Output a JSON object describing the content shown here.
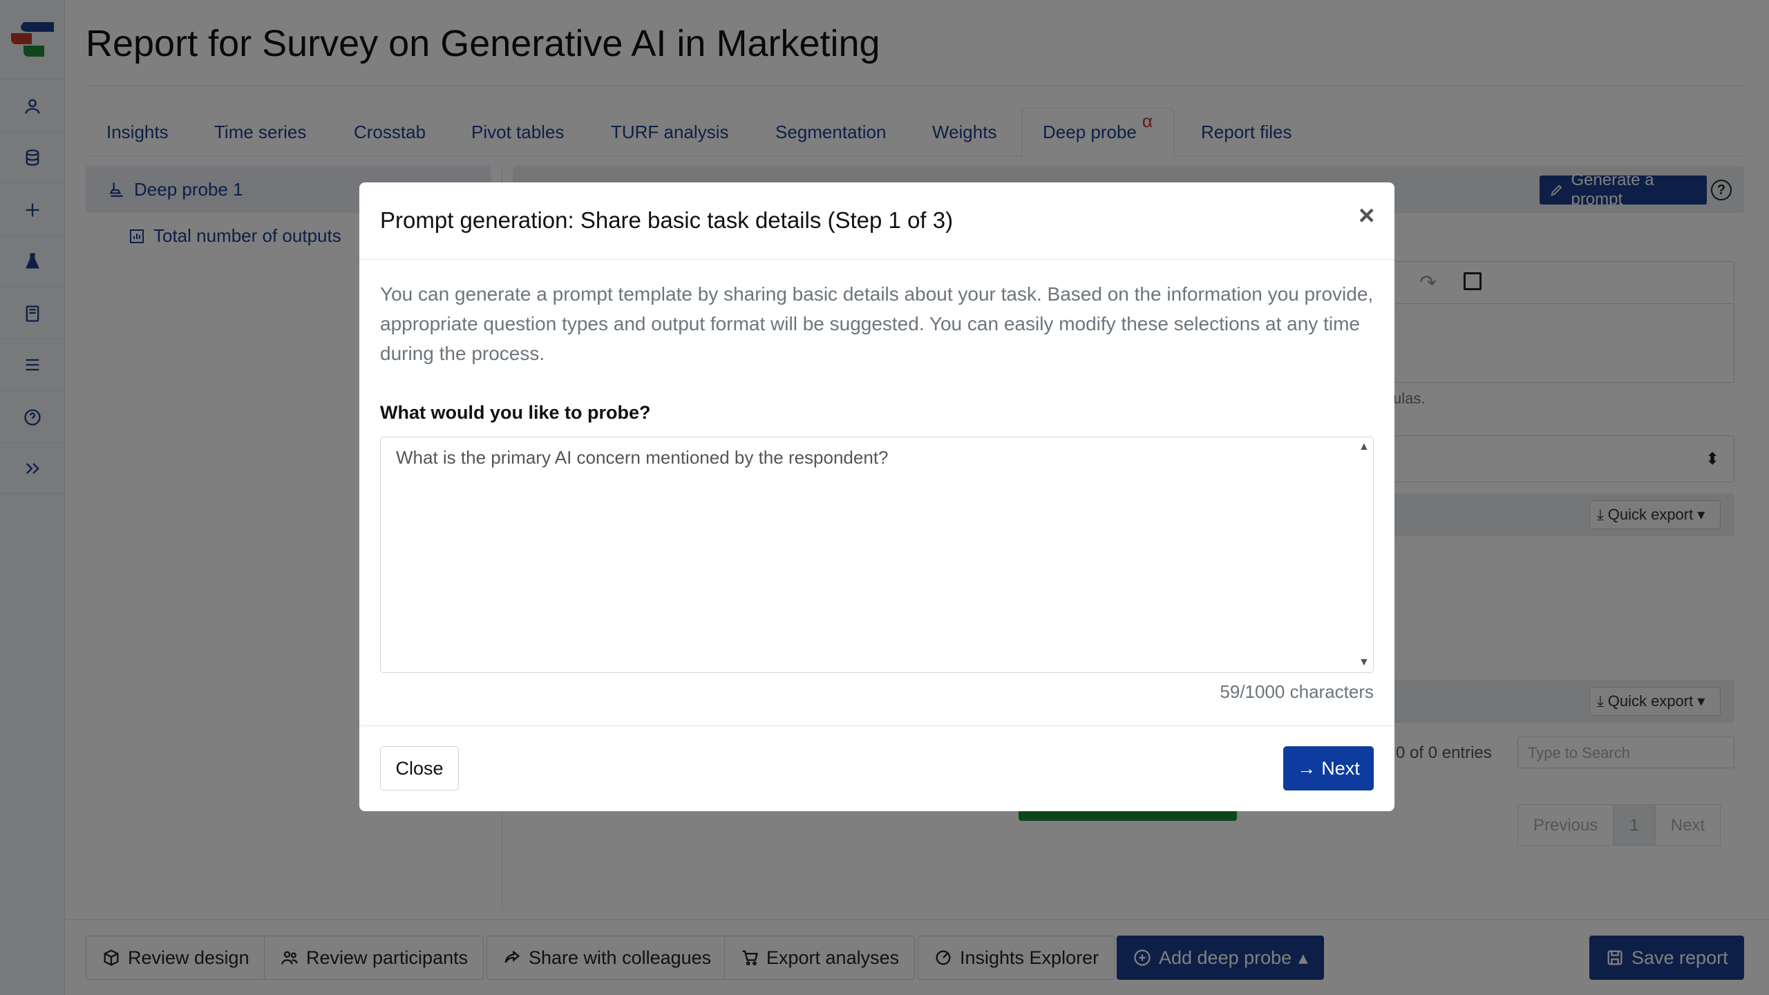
{
  "page": {
    "title": "Report for  Survey on Generative AI in Marketing"
  },
  "tabs": [
    {
      "label": "Insights"
    },
    {
      "label": "Time series"
    },
    {
      "label": "Crosstab"
    },
    {
      "label": "Pivot tables"
    },
    {
      "label": "TURF analysis"
    },
    {
      "label": "Segmentation"
    },
    {
      "label": "Weights"
    },
    {
      "label": "Deep probe",
      "badge": "α",
      "active": true
    },
    {
      "label": "Report files"
    }
  ],
  "sidebar_nav": {
    "item": "Deep probe 1",
    "subitem": "Total number of outputs"
  },
  "main": {
    "generate_btn": "Generate a prompt",
    "editor_hint": "ulas.",
    "quick_export": "Quick export",
    "entries": "0 of 0 entries",
    "search_placeholder": "Type to Search",
    "pager": {
      "prev": "Previous",
      "page": "1",
      "next": "Next"
    }
  },
  "footer": {
    "review_design": "Review design",
    "review_participants": "Review participants",
    "share": "Share with colleagues",
    "export": "Export analyses",
    "insights_explorer": "Insights Explorer",
    "add_probe": "Add deep probe",
    "save": "Save report"
  },
  "modal": {
    "title": "Prompt generation: Share basic task details (Step 1 of 3)",
    "close_x": "×",
    "description": "You can generate a prompt template by sharing basic details about your task. Based on the information you provide, appropriate question types and output format will be suggested. You can easily modify these selections at any time during the process.",
    "question_label": "What would you like to probe?",
    "textarea_value": "What is the primary AI concern mentioned by the respondent?",
    "char_count": "59/1000 characters",
    "close_button": "Close",
    "next_button": "Next"
  },
  "colors": {
    "brand": "#1a3f8f",
    "next": "#0d3b9e",
    "alpha": "#c0392b"
  }
}
